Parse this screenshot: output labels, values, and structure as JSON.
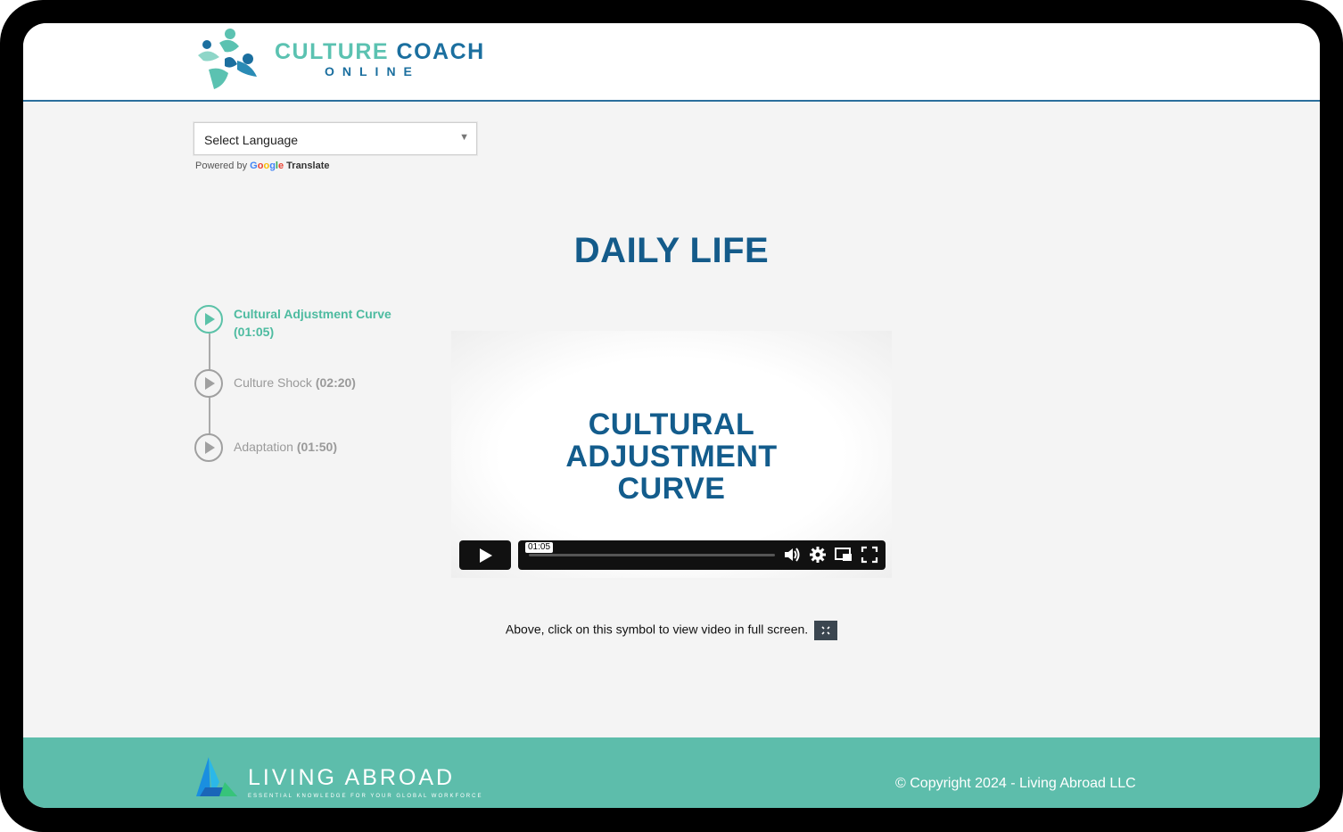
{
  "header": {
    "logo_title_1": "CULTURE",
    "logo_title_2": "COACH",
    "logo_subtitle": "ONLINE"
  },
  "translate": {
    "select_label": "Select Language",
    "powered_by": "Powered by",
    "google": [
      "G",
      "o",
      "o",
      "g",
      "l",
      "e"
    ],
    "translate_word": "Translate"
  },
  "page": {
    "title": "DAILY LIFE"
  },
  "playlist": {
    "items": [
      {
        "title": "Cultural Adjustment Curve",
        "duration": "(01:05)",
        "active": true
      },
      {
        "title": "Culture Shock",
        "duration": "(02:20)",
        "active": false
      },
      {
        "title": "Adaptation",
        "duration": "(01:50)",
        "active": false
      }
    ]
  },
  "video": {
    "title_lines": [
      "CULTURAL",
      "ADJUSTMENT",
      "CURVE"
    ],
    "time": "01:05",
    "progress_fraction": 0,
    "icons": [
      "play-icon",
      "volume-icon",
      "settings-icon",
      "pip-icon",
      "fullscreen-icon"
    ]
  },
  "hint": {
    "text": "Above, click on this symbol to view video in full screen."
  },
  "footer": {
    "brand": "LIVING ABROAD",
    "tagline": "ESSENTIAL KNOWLEDGE FOR YOUR GLOBAL WORKFORCE",
    "copyright": "© Copyright 2024 - Living Abroad LLC"
  },
  "colors": {
    "brand_teal": "#5bc2b1",
    "brand_blue": "#1b6f9f",
    "title_blue": "#145b8a",
    "footer_bg": "#5dbdab"
  }
}
